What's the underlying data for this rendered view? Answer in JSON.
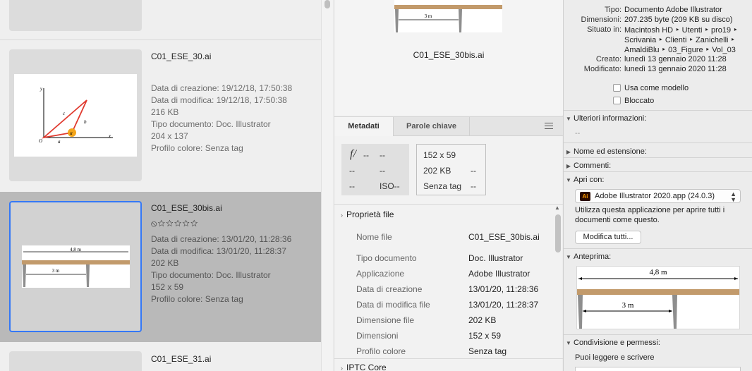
{
  "list": {
    "items": [
      {
        "name": "C01_ESE_30.ai",
        "meta": [
          "Data di creazione: 19/12/18, 17:50:38",
          "Data di modifica: 19/12/18, 17:50:38",
          "216 KB",
          "Tipo documento: Doc. Illustrator",
          "204 x 137",
          "Profilo colore: Senza tag"
        ],
        "thumb_labels": {
          "y": "y",
          "x": "x",
          "o": "O",
          "a": "a",
          "b": "b",
          "c": "c",
          "alpha": "α"
        }
      },
      {
        "name": "C01_ESE_30bis.ai",
        "rating": "⦸☆☆☆☆☆",
        "meta": [
          "Data di creazione: 13/01/20, 11:28:36",
          "Data di modifica: 13/01/20, 11:28:37",
          "202 KB",
          "Tipo documento: Doc. Illustrator",
          "152 x 59",
          "Profilo colore: Senza tag"
        ]
      },
      {
        "name": "C01_ESE_31.ai"
      }
    ],
    "drawing_labels": {
      "top": "4,8 m",
      "bottom": "3 m"
    }
  },
  "preview": {
    "file_name": "C01_ESE_30bis.ai",
    "drawing_label": "3 m"
  },
  "tabs": {
    "metadata": "Metadati",
    "keywords": "Parole chiave"
  },
  "exif": {
    "fstop_icon": "f/",
    "c1": [
      "--",
      "--",
      "--"
    ],
    "c2": [
      "--",
      "--",
      "ISO--"
    ],
    "c3": [
      "152 x 59",
      "202 KB",
      "Senza tag"
    ],
    "c4": [
      "--",
      "--"
    ]
  },
  "file_props": {
    "section": "Proprietà file",
    "rows": [
      {
        "k": "Nome file",
        "v": "C01_ESE_30bis.ai"
      },
      {
        "k": "Tipo documento",
        "v": "Doc. Illustrator"
      },
      {
        "k": "Applicazione",
        "v": "Adobe Illustrator"
      },
      {
        "k": "Data di creazione",
        "v": "13/01/20, 11:28:36"
      },
      {
        "k": "Data di modifica file",
        "v": "13/01/20, 11:28:37"
      },
      {
        "k": "Dimensione file",
        "v": "202 KB"
      },
      {
        "k": "Dimensioni",
        "v": "152 x 59"
      },
      {
        "k": "Profilo colore",
        "v": "Senza tag"
      }
    ],
    "next_section": "IPTC Core"
  },
  "info": {
    "rows": [
      {
        "k": "Tipo:",
        "v": "Documento Adobe Illustrator"
      },
      {
        "k": "Dimensioni:",
        "v": "207.235 byte (209 KB su disco)"
      },
      {
        "k": "Situato in:",
        "v": "Macintosh HD ‣ Utenti ‣ pro19 ‣"
      },
      {
        "k": "",
        "v": "Scrivania ‣ Clienti ‣ Zanichelli ‣"
      },
      {
        "k": "",
        "v": "AmaldiBlu ‣ 03_Figure ‣ Vol_03"
      },
      {
        "k": "Creato:",
        "v": "lunedì 13 gennaio 2020 11:28"
      },
      {
        "k": "Modificato:",
        "v": "lunedì 13 gennaio 2020 11:28"
      }
    ],
    "stationery": "Usa come modello",
    "locked": "Bloccato",
    "more_info": "Ulteriori informazioni:",
    "more_info_value": "--",
    "name_ext": "Nome ed estensione:",
    "comments": "Commenti:",
    "open_with": "Apri con:",
    "app_name": "Adobe Illustrator 2020.app (24.0.3)",
    "app_icon": "Ai",
    "open_with_help_1": "Utilizza questa applicazione per aprire tutti i",
    "open_with_help_2": "documenti come questo.",
    "change_all": "Modifica tutti...",
    "preview": "Anteprima:",
    "preview_labels": {
      "top": "4,8 m",
      "bottom": "3 m"
    },
    "sharing": "Condivisione e permessi:",
    "sharing_value": "Puoi leggere e scrivere"
  },
  "colors": {
    "selection_border": "#3478f6",
    "plank": "#c29a6b",
    "triangle": "#e03a2f"
  }
}
